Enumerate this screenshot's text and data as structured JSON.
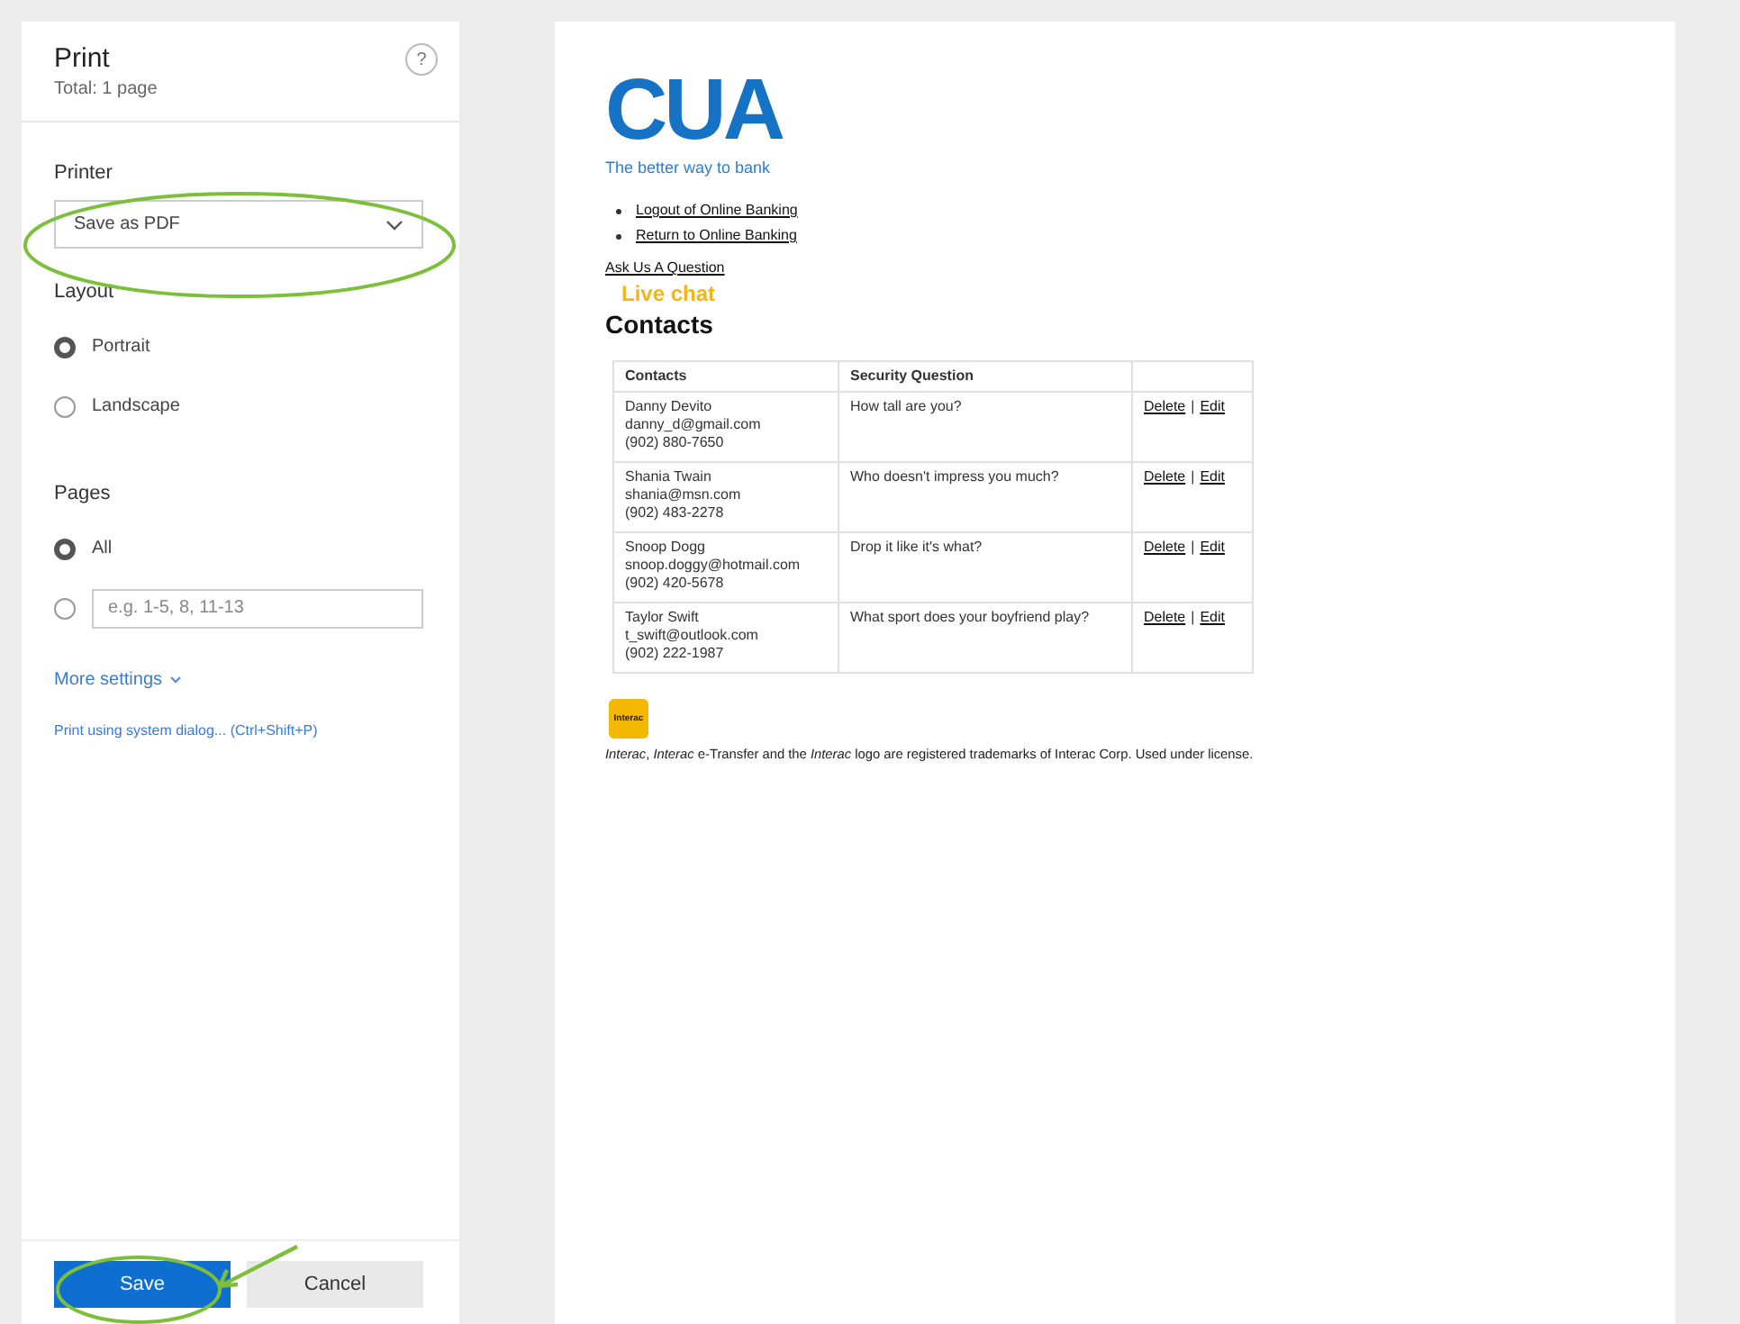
{
  "panel": {
    "title": "Print",
    "help": "?",
    "total": "Total: 1 page",
    "printer": {
      "label": "Printer",
      "value": "Save as PDF"
    },
    "layout": {
      "label": "Layout",
      "options": [
        {
          "label": "Portrait",
          "selected": true
        },
        {
          "label": "Landscape",
          "selected": false
        }
      ]
    },
    "pages": {
      "label": "Pages",
      "options": [
        {
          "kind": "text",
          "label": "All",
          "selected": true
        },
        {
          "kind": "field",
          "placeholder": "e.g. 1-5, 8, 11-13",
          "selected": false
        }
      ]
    },
    "more_settings": "More settings",
    "system_dialog": "Print using system dialog... (Ctrl+Shift+P)",
    "buttons": [
      {
        "label": "Save",
        "primary": true
      },
      {
        "label": "Cancel",
        "primary": false
      }
    ]
  },
  "preview": {
    "logo": {
      "text": "CUA",
      "tagline": "The better way to bank"
    },
    "links": [
      "Logout of Online Banking",
      "Return to Online Banking"
    ],
    "ask": "Ask Us A Question",
    "live_chat": "Live chat",
    "heading": "Contacts",
    "table": {
      "columns": [
        "Contacts",
        "Security Question"
      ],
      "rows": [
        {
          "name": "Danny Devito",
          "email": "danny_d@gmail.com",
          "phone": "(902) 880-7650",
          "question": "How tall are you?",
          "delete": "Delete",
          "separator": "|",
          "edit": "Edit"
        },
        {
          "name": "Shania Twain",
          "email": "shania@msn.com",
          "phone": "(902) 483-2278",
          "question": "Who doesn't impress you much?",
          "delete": "Delete",
          "separator": "|",
          "edit": "Edit"
        },
        {
          "name": "Snoop Dogg",
          "email": "snoop.doggy@hotmail.com",
          "phone": "(902) 420-5678",
          "question": "Drop it like it's what?",
          "delete": "Delete",
          "separator": "|",
          "edit": "Edit"
        },
        {
          "name": "Taylor Swift",
          "email": "t_swift@outlook.com",
          "phone": "(902) 222-1987",
          "question": "What sport does your boyfriend play?",
          "delete": "Delete",
          "separator": "|",
          "edit": "Edit"
        }
      ]
    },
    "badge": "Interac",
    "footer": "*Interac*, *Interac* e-Transfer and the *Interac* logo are registered trademarks of Interac Corp. Used under license."
  }
}
